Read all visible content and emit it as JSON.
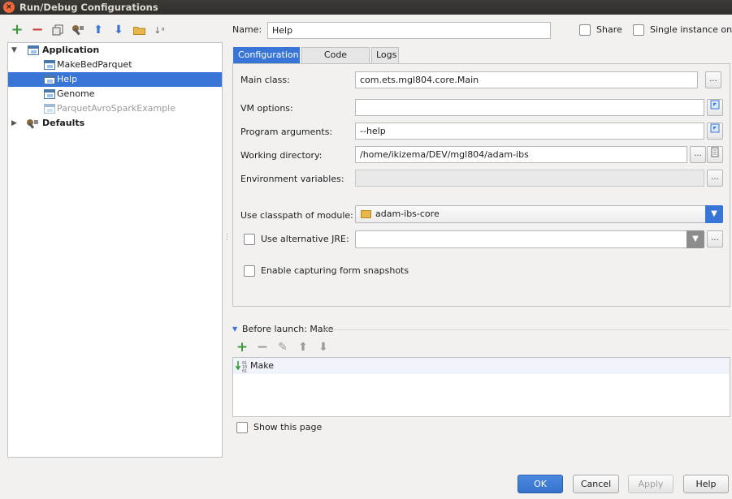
{
  "window": {
    "title": "Run/Debug Configurations",
    "close_glyph": "×"
  },
  "toolbar": {
    "add": "+",
    "remove": "−",
    "up": "⬆",
    "down": "⬇",
    "sort_glyph": "↓ᵃ"
  },
  "tree": {
    "application_label": "Application",
    "items": [
      "MakeBedParquet",
      "Help",
      "Genome",
      "ParquetAvroSparkExample"
    ],
    "defaults_label": "Defaults",
    "expand_glyph": "▼",
    "collapse_glyph": "▶"
  },
  "form": {
    "name_label": "Name:",
    "name_value": "Help",
    "share_label": "Share",
    "single_instance_label": "Single instance only",
    "tabs": [
      "Configuration",
      "Code Coverage",
      "Logs"
    ],
    "main_class_label": "Main class:",
    "main_class_value": "com.ets.mgl804.core.Main",
    "vm_options_label": "VM options:",
    "vm_options_value": "",
    "program_args_label": "Program arguments:",
    "program_args_value": "--help",
    "working_dir_label": "Working directory:",
    "working_dir_value": "/home/ikizema/DEV/mgl804/adam-ibs",
    "env_vars_label": "Environment variables:",
    "env_vars_value": "",
    "classpath_label": "Use classpath of module:",
    "classpath_value": "adam-ibs-core",
    "alt_jre_label": "Use alternative JRE:",
    "alt_jre_value": "",
    "snapshots_label": "Enable capturing form snapshots",
    "ellipsis": "...",
    "combo_arrow": "▼"
  },
  "before_launch": {
    "header": "Before launch: Make",
    "toggle_glyph": "▼",
    "items": [
      "Make"
    ],
    "toolbar": {
      "add": "+",
      "remove": "−",
      "edit": "✎",
      "up": "⬆",
      "down": "⬇"
    }
  },
  "show_page_label": "Show this page",
  "buttons": {
    "ok": "OK",
    "cancel": "Cancel",
    "apply": "Apply",
    "help": "Help"
  },
  "colors": {
    "accent": "#3875d7",
    "add_green": "#3c9a3c",
    "remove_red": "#c83a3a"
  }
}
